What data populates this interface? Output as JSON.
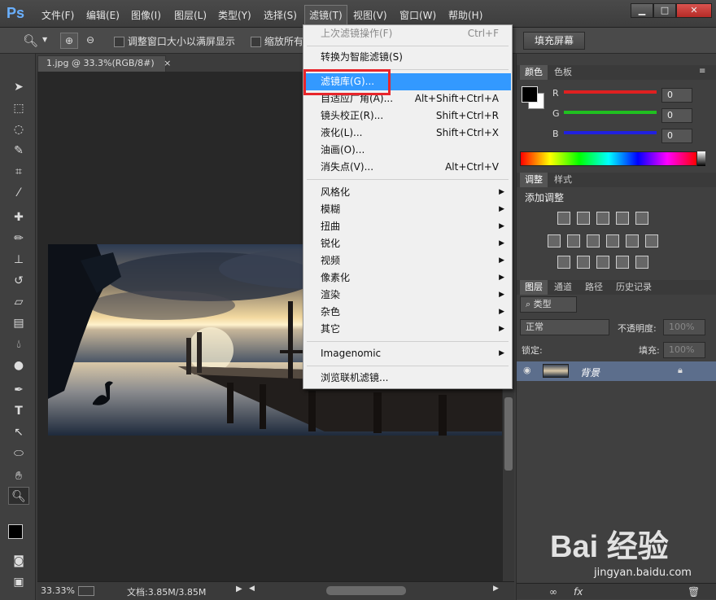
{
  "app": {
    "logo": "Ps"
  },
  "menubar": {
    "items": [
      "文件(F)",
      "编辑(E)",
      "图像(I)",
      "图层(L)",
      "类型(Y)",
      "选择(S)",
      "滤镜(T)",
      "视图(V)",
      "窗口(W)",
      "帮助(H)"
    ],
    "active_index": 6
  },
  "window_controls": {
    "minimize": "▁",
    "maximize": "□",
    "close": "✕"
  },
  "options_bar": {
    "resize_window": "调整窗口大小以满屏显示",
    "zoom_all": "缩放所有",
    "fill_screen": "填充屏幕"
  },
  "document": {
    "tab_title": "1.jpg @ 33.3%(RGB/8#)",
    "close": "×"
  },
  "status": {
    "zoom": "33.33%",
    "doc_size": "文档:3.85M/3.85M"
  },
  "filter_menu": {
    "last_filter": {
      "label": "上次滤镜操作(F)",
      "shortcut": "Ctrl+F"
    },
    "smart_filter": "转换为智能滤镜(S)",
    "group1": [
      {
        "label": "滤镜库(G)...",
        "shortcut": ""
      },
      {
        "label": "自适应广角(A)...",
        "shortcut": "Alt+Shift+Ctrl+A"
      },
      {
        "label": "镜头校正(R)...",
        "shortcut": "Shift+Ctrl+R"
      },
      {
        "label": "液化(L)...",
        "shortcut": "Shift+Ctrl+X"
      },
      {
        "label": "油画(O)...",
        "shortcut": ""
      },
      {
        "label": "消失点(V)...",
        "shortcut": "Alt+Ctrl+V"
      }
    ],
    "submenus": [
      "风格化",
      "模糊",
      "扭曲",
      "锐化",
      "视频",
      "像素化",
      "渲染",
      "杂色",
      "其它"
    ],
    "plugin": "Imagenomic",
    "browse": "浏览联机滤镜..."
  },
  "color_panel": {
    "tabs": [
      "颜色",
      "色板"
    ],
    "channels": [
      {
        "name": "R",
        "value": "0",
        "color": "#e02020"
      },
      {
        "name": "G",
        "value": "0",
        "color": "#20c020"
      },
      {
        "name": "B",
        "value": "0",
        "color": "#2020e0"
      }
    ]
  },
  "adjust_panel": {
    "tabs": [
      "调整",
      "样式"
    ],
    "title": "添加调整"
  },
  "layers_panel": {
    "tabs": [
      "图层",
      "通道",
      "路径",
      "历史记录"
    ],
    "filter_type": "类型",
    "blend_mode": "正常",
    "opacity_label": "不透明度:",
    "opacity_value": "100%",
    "lock_label": "锁定:",
    "fill_label": "填充:",
    "fill_value": "100%",
    "layer_name": "背景"
  },
  "watermark": {
    "brand": "Bai  经验",
    "site": "jingyan.baidu.com"
  }
}
